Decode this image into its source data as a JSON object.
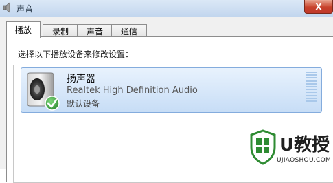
{
  "window": {
    "title": "声音",
    "close_label": "X"
  },
  "tabs": [
    {
      "label": "播放",
      "active": true
    },
    {
      "label": "录制",
      "active": false
    },
    {
      "label": "声音",
      "active": false
    },
    {
      "label": "通信",
      "active": false
    }
  ],
  "instruction": "选择以下播放设备来修改设置：",
  "devices": [
    {
      "name": "扬声器",
      "description": "Realtek High Definition Audio",
      "status": "默认设备",
      "icon": "speaker-icon",
      "is_default": true
    }
  ],
  "watermark": {
    "name": "U教授",
    "url": "UJIAOSHOU.COM"
  },
  "colors": {
    "accent": "#2e8b32",
    "selection": "#c7ddf6",
    "close": "#c7412b"
  }
}
